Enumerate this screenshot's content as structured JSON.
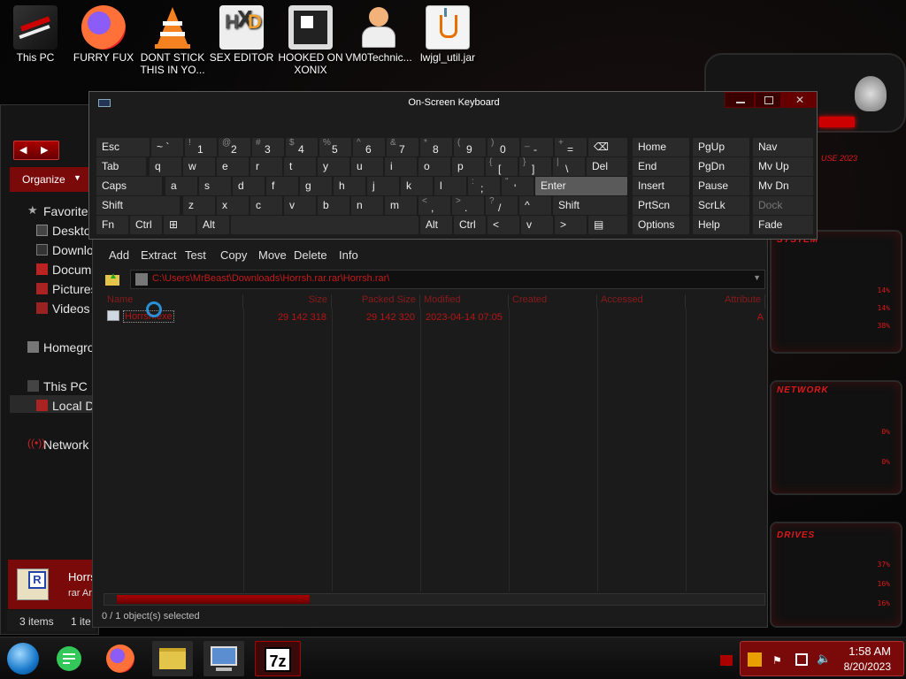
{
  "desktop_icons": [
    {
      "label": "This PC",
      "icon": "computer-icon"
    },
    {
      "label": "FURRY FUX",
      "icon": "firefox-icon"
    },
    {
      "label": "DONT STICK THIS IN YO...",
      "icon": "vlc-cone-icon"
    },
    {
      "label": "SEX EDITOR",
      "icon": "hxd-editor-icon"
    },
    {
      "label": "HOOKED ON XONIX",
      "icon": "game-icon"
    },
    {
      "label": "VM0Technic...",
      "icon": "person-icon"
    },
    {
      "label": "lwjgl_util.jar",
      "icon": "java-jar-icon"
    }
  ],
  "widgets": {
    "system": {
      "title": "SYSTEM",
      "values": [
        "14%",
        "14%",
        "38%"
      ]
    },
    "network": {
      "title": "NETWORK",
      "values": [
        "0%",
        "0%"
      ]
    },
    "drives": {
      "title": "DRIVES",
      "values": [
        "37%",
        "16%",
        "16%"
      ]
    },
    "top_text": "USE 2023"
  },
  "explorer": {
    "organize": "Organize",
    "nav": [
      {
        "label": "Favorites",
        "icon": "star-icon"
      },
      {
        "label": "Deskto",
        "icon": "desktop-icon"
      },
      {
        "label": "Downloa",
        "icon": "download-icon"
      },
      {
        "label": "Docume",
        "icon": "document-icon"
      },
      {
        "label": "Pictures",
        "icon": "picture-icon"
      },
      {
        "label": "Videos",
        "icon": "video-icon"
      },
      {
        "label": "Homegrou",
        "icon": "homegroup-icon"
      },
      {
        "label": "This PC",
        "icon": "computer-icon"
      },
      {
        "label": "Local Di",
        "icon": "drive-icon"
      },
      {
        "label": "Network",
        "icon": "network-icon"
      }
    ],
    "preview_name": "Horrs",
    "preview_type": "rar Ar",
    "status_items": "3 items",
    "status_selected": "1 ite"
  },
  "osk": {
    "title": "On-Screen Keyboard",
    "rows": [
      [
        [
          "Esc",
          ""
        ],
        [
          "~ `",
          ""
        ],
        [
          "1",
          "!"
        ],
        [
          "2",
          "@"
        ],
        [
          "3",
          "#"
        ],
        [
          "4",
          "$"
        ],
        [
          "5",
          "%"
        ],
        [
          "6",
          "^"
        ],
        [
          "7",
          "&"
        ],
        [
          "8",
          "*"
        ],
        [
          "9",
          "("
        ],
        [
          "0",
          ")"
        ],
        [
          "-",
          "_"
        ],
        [
          "=",
          "+"
        ],
        [
          "⌫",
          ""
        ]
      ],
      [
        [
          "Tab",
          ""
        ],
        [
          "q",
          ""
        ],
        [
          "w",
          ""
        ],
        [
          "e",
          ""
        ],
        [
          "r",
          ""
        ],
        [
          "t",
          ""
        ],
        [
          "y",
          ""
        ],
        [
          "u",
          ""
        ],
        [
          "i",
          ""
        ],
        [
          "o",
          ""
        ],
        [
          "p",
          ""
        ],
        [
          "[",
          "{"
        ],
        [
          "]",
          "}"
        ],
        [
          "\\",
          "|"
        ],
        [
          "Del",
          ""
        ]
      ],
      [
        [
          "Caps",
          ""
        ],
        [
          "a",
          ""
        ],
        [
          "s",
          ""
        ],
        [
          "d",
          ""
        ],
        [
          "f",
          ""
        ],
        [
          "g",
          ""
        ],
        [
          "h",
          ""
        ],
        [
          "j",
          ""
        ],
        [
          "k",
          ""
        ],
        [
          "l",
          ""
        ],
        [
          ";",
          ":"
        ],
        [
          "'",
          "\""
        ],
        [
          "Enter",
          ""
        ]
      ],
      [
        [
          "Shift",
          ""
        ],
        [
          "z",
          ""
        ],
        [
          "x",
          ""
        ],
        [
          "c",
          ""
        ],
        [
          "v",
          ""
        ],
        [
          "b",
          ""
        ],
        [
          "n",
          ""
        ],
        [
          "m",
          ""
        ],
        [
          ",",
          "<"
        ],
        [
          ".",
          ">"
        ],
        [
          "/",
          "?"
        ],
        [
          "^",
          ""
        ],
        [
          "Shift",
          ""
        ]
      ],
      [
        [
          "Fn",
          ""
        ],
        [
          "Ctrl",
          ""
        ],
        [
          "⊞",
          ""
        ],
        [
          "Alt",
          ""
        ],
        [
          "",
          ""
        ],
        [
          "Alt",
          ""
        ],
        [
          "Ctrl",
          ""
        ],
        [
          "<",
          ""
        ],
        [
          "v",
          ""
        ],
        [
          ">",
          ""
        ],
        [
          "▤",
          ""
        ]
      ]
    ],
    "nav_keys": [
      [
        "Home",
        "PgUp",
        "Nav"
      ],
      [
        "End",
        "PgDn",
        "Mv Up"
      ],
      [
        "Insert",
        "Pause",
        "Mv Dn"
      ],
      [
        "PrtScn",
        "ScrLk",
        "Dock"
      ],
      [
        "Options",
        "Help",
        "Fade"
      ]
    ]
  },
  "sevenzip": {
    "toolbar": [
      "Add",
      "Extract",
      "Test",
      "Copy",
      "Move",
      "Delete",
      "Info"
    ],
    "address": "C:\\Users\\MrBeast\\Downloads\\Horrsh.rar.rar\\Horrsh.rar\\",
    "columns": [
      "Name",
      "Size",
      "Packed Size",
      "Modified",
      "Created",
      "Accessed",
      "Attribute"
    ],
    "rows": [
      {
        "name": "Horrsh.exe",
        "size": "29 142 318",
        "packed": "29 142 320",
        "modified": "2023-04-14 07:05",
        "attr": "A"
      }
    ],
    "status": "0 / 1 object(s) selected"
  },
  "taskbar": {
    "items": [
      "start-orb-icon",
      "notes-app-icon",
      "firefox-icon",
      "file-explorer-icon",
      "remote-desktop-icon",
      "7zip-icon"
    ],
    "time": "1:58 AM",
    "date": "8/20/2023"
  },
  "colors": {
    "accent": "#c21b1b",
    "tray": "#7a0a0a"
  }
}
